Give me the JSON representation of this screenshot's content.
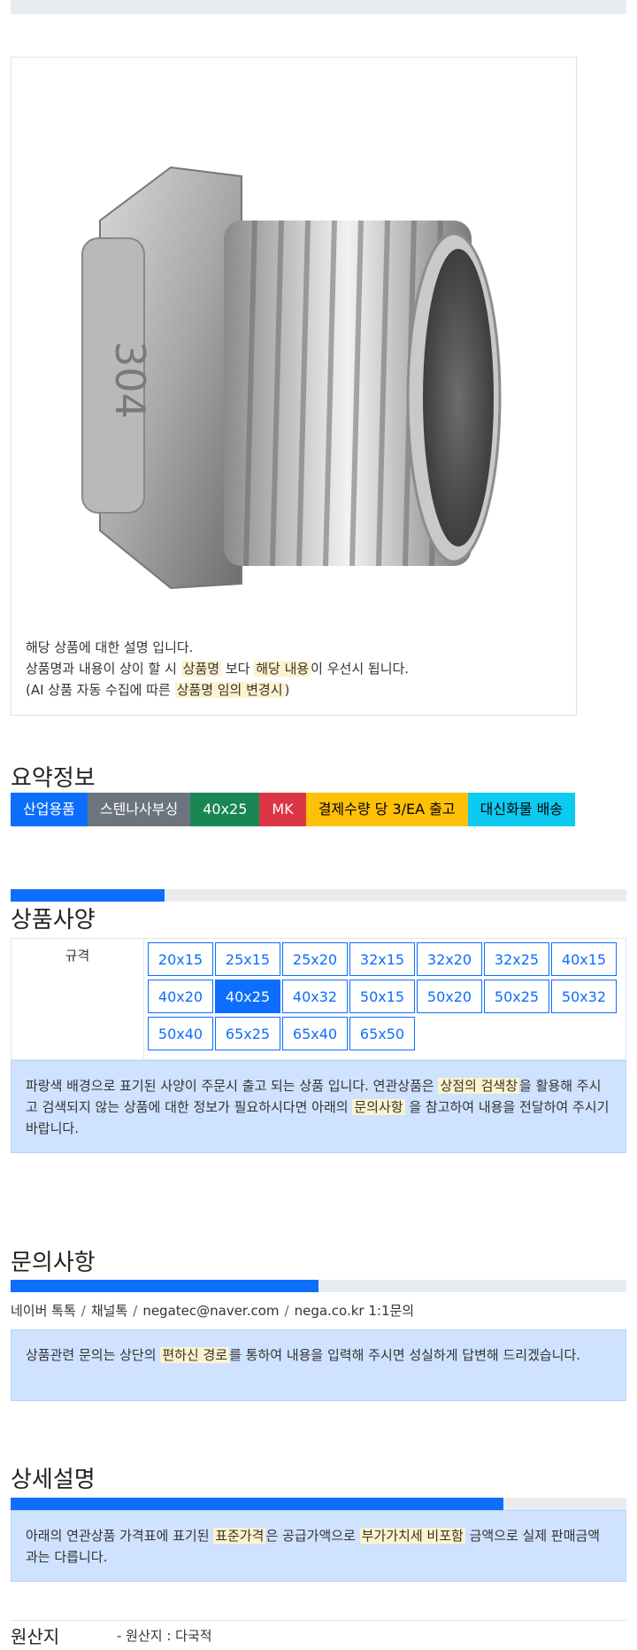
{
  "product": {
    "image_alt": "304 stainless steel hex bushing",
    "description": {
      "line1": "해당 상품에 대한 설명 입니다.",
      "line2_pre": "상품명과 내용이 상이 할 시 ",
      "line2_hl1": "상품명",
      "line2_mid": " 보다 ",
      "line2_hl2": "해당 내용",
      "line2_post": "이 우선시 됩니다.",
      "line3_pre": "(AI 상품 자동 수집에 따른 ",
      "line3_hl": "상품명 임의 변경시",
      "line3_post": ")"
    }
  },
  "summary": {
    "title": "요약정보",
    "badges": [
      "산업용품",
      "스텐나사부싱",
      "40x25",
      "MK",
      "결제수량 당 3/EA 출고",
      "대신화물 배송"
    ]
  },
  "spec": {
    "title": "상품사양",
    "progress": 0.25,
    "label": "규격",
    "options": [
      "20x15",
      "25x15",
      "25x20",
      "32x15",
      "32x20",
      "32x25",
      "40x15",
      "40x20",
      "40x25",
      "40x32",
      "50x15",
      "50x20",
      "50x25",
      "50x32",
      "50x40",
      "65x25",
      "65x40",
      "65x50"
    ],
    "selected": "40x25",
    "notice": {
      "pre": "파랑색 배경으로 표기된 사양이 주문시 출고 되는 상품 입니다. 연관상품은 ",
      "hl1": "상점의 검색창",
      "mid": "을 활용해 주시고 검색되지 않는 상품에 대한 정보가 필요하시다면 아래의 ",
      "hl2": "문의사항",
      "post": " 을 참고하여 내용을 전달하여 주시기 바랍니다."
    }
  },
  "inquiry": {
    "title": "문의사항",
    "progress": 0.5,
    "channels": [
      "네이버 톡톡",
      "채널톡",
      "negatec@naver.com",
      "nega.co.kr 1:1문의"
    ],
    "notice": {
      "pre": "상품관련 문의는 상단의 ",
      "hl": "편하신 경로",
      "post": "를 통하여 내용을 입력해 주시면 성실하게 답변해 드리겠습니다."
    }
  },
  "detail": {
    "title": "상세설명",
    "progress": 0.8,
    "notice": {
      "pre": "아래의 연관상품 가격표에 표기된 ",
      "hl1": "표준가격",
      "mid": "은 공급가액으로 ",
      "hl2": "부가가치세 비포함",
      "post": " 금액으로 실제 판매금액과는 다릅니다."
    }
  },
  "origin": {
    "label": "원산지",
    "value": "- 원산지 : 다국적"
  }
}
